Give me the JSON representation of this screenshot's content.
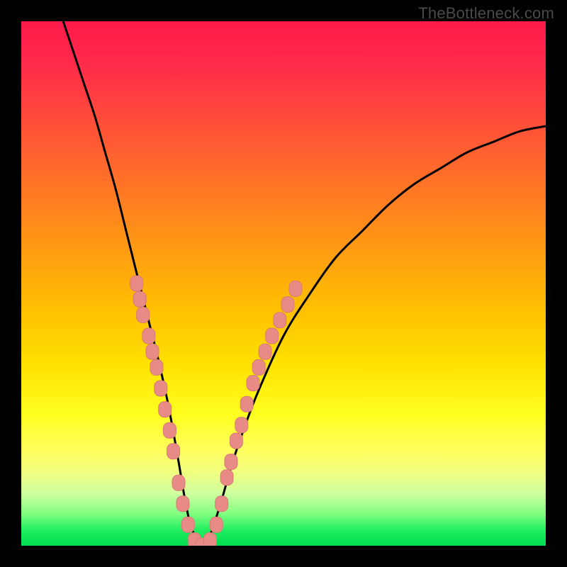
{
  "watermark": "TheBottleneck.com",
  "chart_data": {
    "type": "line",
    "title": "",
    "xlabel": "",
    "ylabel": "",
    "xlim": [
      0,
      100
    ],
    "ylim": [
      0,
      100
    ],
    "series": [
      {
        "name": "bottleneck-curve",
        "x": [
          8,
          10,
          12,
          14,
          16,
          18,
          20,
          22,
          24,
          26,
          28,
          30,
          31,
          32,
          33,
          34,
          35,
          36,
          38,
          40,
          42,
          45,
          50,
          55,
          60,
          65,
          70,
          75,
          80,
          85,
          90,
          95,
          100
        ],
        "y": [
          100,
          94,
          88,
          82,
          75,
          68,
          60,
          52,
          44,
          36,
          27,
          16,
          10,
          5,
          2,
          0,
          0,
          2,
          8,
          15,
          21,
          29,
          40,
          48,
          55,
          60,
          65,
          69,
          72,
          75,
          77,
          79,
          80
        ]
      }
    ],
    "marker_clusters": [
      {
        "name": "left-cluster",
        "points": [
          {
            "x": 22.0,
            "y": 50
          },
          {
            "x": 22.6,
            "y": 47
          },
          {
            "x": 23.2,
            "y": 44
          },
          {
            "x": 24.3,
            "y": 40
          },
          {
            "x": 25.0,
            "y": 37
          },
          {
            "x": 25.8,
            "y": 34
          },
          {
            "x": 26.6,
            "y": 30
          },
          {
            "x": 27.4,
            "y": 26
          },
          {
            "x": 28.3,
            "y": 22
          },
          {
            "x": 29.0,
            "y": 18
          },
          {
            "x": 30.0,
            "y": 12
          },
          {
            "x": 30.8,
            "y": 8
          },
          {
            "x": 31.8,
            "y": 4
          },
          {
            "x": 33.0,
            "y": 1
          },
          {
            "x": 34.5,
            "y": 0
          },
          {
            "x": 36.0,
            "y": 1
          }
        ]
      },
      {
        "name": "right-cluster",
        "points": [
          {
            "x": 37.2,
            "y": 4
          },
          {
            "x": 38.2,
            "y": 8
          },
          {
            "x": 39.2,
            "y": 13
          },
          {
            "x": 40.0,
            "y": 16
          },
          {
            "x": 41.0,
            "y": 20
          },
          {
            "x": 42.0,
            "y": 23
          },
          {
            "x": 43.0,
            "y": 27
          },
          {
            "x": 44.2,
            "y": 31
          },
          {
            "x": 45.3,
            "y": 34
          },
          {
            "x": 46.5,
            "y": 37
          },
          {
            "x": 47.8,
            "y": 40
          },
          {
            "x": 49.3,
            "y": 43
          },
          {
            "x": 50.8,
            "y": 46
          },
          {
            "x": 52.3,
            "y": 49
          }
        ]
      }
    ],
    "colors": {
      "curve": "#000000",
      "marker_fill": "#e88a86",
      "marker_stroke": "#d87a76"
    }
  }
}
